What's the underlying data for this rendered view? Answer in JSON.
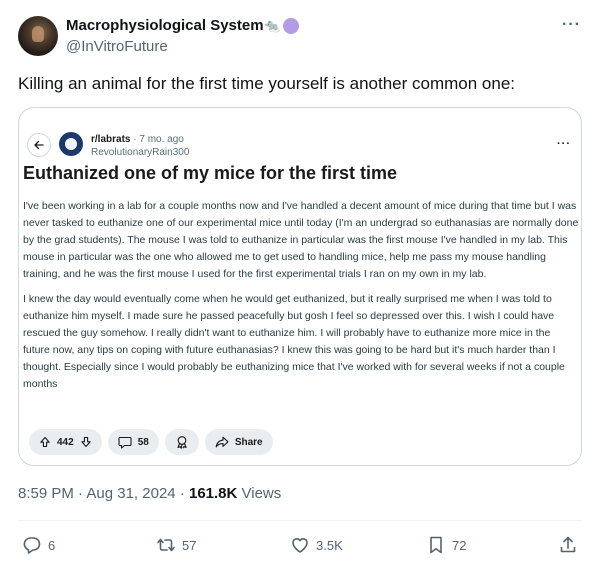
{
  "author": {
    "display_name": "Macrophysiological System",
    "handle": "@InVitroFuture",
    "badge_mouse": "🐀",
    "more": "···"
  },
  "tweet": {
    "text": "Killing an animal for the first time yourself is another common one:"
  },
  "card": {
    "subreddit": "r/labrats",
    "dot": "·",
    "age": "7 mo. ago",
    "username": "RevolutionaryRain300",
    "more": "···",
    "title": "Euthanized one of my mice for the first time",
    "paragraphs": [
      "I've been working in a lab for a couple months now and I've handled a decent amount of mice during that time but I was never tasked to euthanize one of our experimental mice until today (I'm an undergrad so euthanasias are normally done by the grad students). The mouse I was told to euthanize in particular was the first mouse I've handled in my lab. This mouse in particular was the one who allowed me to get used to handling mice, help me pass my mouse handling training, and he was the first mouse I used for the first experimental trials I ran on my own in my lab.",
      "I knew the day would eventually come when he would get euthanized, but it really surprised me when I was told to euthanize him myself. I made sure he passed peacefully but gosh I feel so depressed over this. I wish I could have rescued the guy somehow. I really didn't want to euthanize him. I will probably have to euthanize more mice in the future now, any tips on coping with future euthanasias? I knew this was going to be hard but it's much harder than I thought. Especially since I would probably be euthanizing mice that I've worked with for several weeks if not a couple months"
    ],
    "votes": "442",
    "comments": "58",
    "share_label": "Share"
  },
  "meta": {
    "time": "8:59 PM",
    "sep1": " · ",
    "date": "Aug 31, 2024",
    "sep2": " · ",
    "views_count": "161.8K",
    "views_label": " Views"
  },
  "stats": {
    "replies": "6",
    "reposts": "57",
    "likes": "3.5K",
    "bookmarks": "72"
  },
  "colors": {
    "text_primary": "#0f1419",
    "text_secondary": "#536471",
    "border": "#cfd9de",
    "badge_purple": "#b49be6"
  }
}
